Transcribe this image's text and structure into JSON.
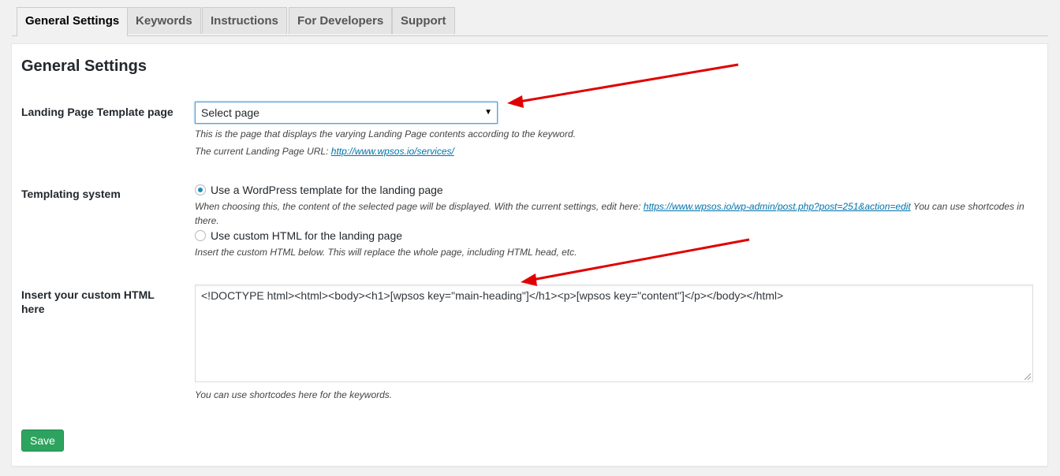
{
  "tabs": [
    {
      "label": "General Settings",
      "active": true
    },
    {
      "label": "Keywords",
      "active": false
    },
    {
      "label": "Instructions",
      "active": false
    },
    {
      "label": "For Developers",
      "active": false
    },
    {
      "label": "Support",
      "active": false
    }
  ],
  "page_title": "General Settings",
  "landing_page": {
    "label": "Landing Page Template page",
    "select_value": "Select page",
    "desc1": "This is the page that displays the varying Landing Page contents according to the keyword.",
    "desc2_prefix": "The current Landing Page URL: ",
    "desc2_link": "http://www.wpsos.io/services/"
  },
  "templating": {
    "label": "Templating system",
    "option1": "Use a WordPress template for the landing page",
    "option1_desc_prefix": "When choosing this, the content of the selected page will be displayed. With the current settings, edit here: ",
    "option1_desc_link": "https://www.wpsos.io/wp-admin/post.php?post=251&action=edit",
    "option1_desc_suffix": " You can use shortcodes in",
    "option1_desc_line2": "there.",
    "option2": "Use custom HTML for the landing page",
    "option2_desc": "Insert the custom HTML below. This will replace the whole page, including HTML head, etc."
  },
  "custom_html": {
    "label_line1": "Insert your custom HTML",
    "label_line2": "here",
    "value": "<!DOCTYPE html><html><body><h1>[wpsos key=\"main-heading\"]</h1><p>[wpsos key=\"content\"]</p></body></html>",
    "desc": "You can use shortcodes here for the keywords."
  },
  "save_label": "Save",
  "colors": {
    "accent_blue": "#0073aa",
    "save_green": "#2ea35f",
    "arrow_red": "#e00000"
  }
}
